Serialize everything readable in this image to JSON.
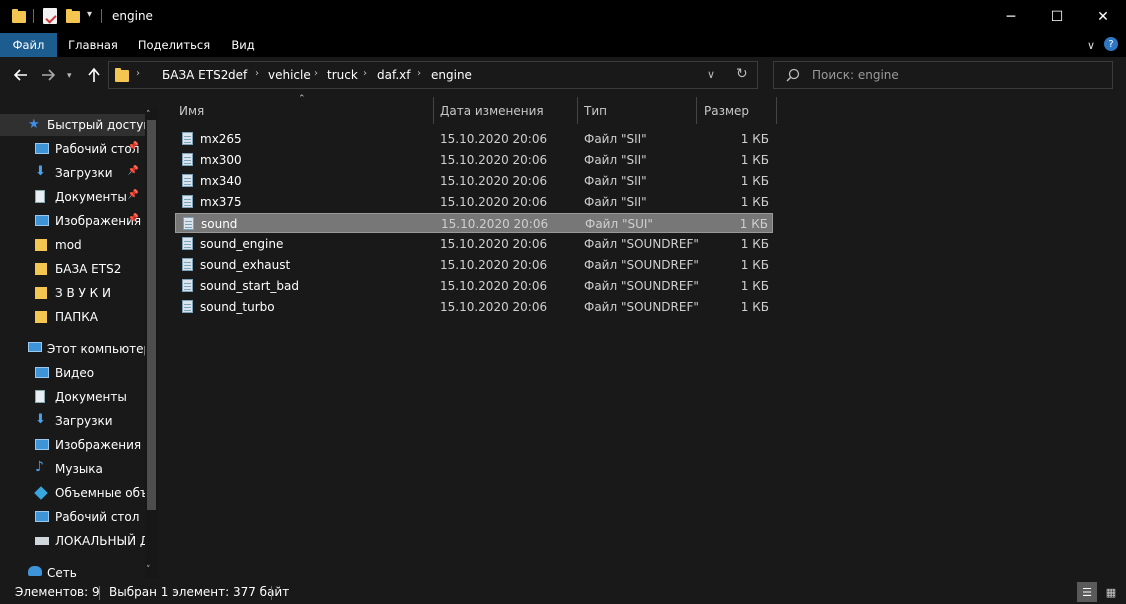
{
  "window": {
    "title": "engine",
    "minimize_glyph": "─",
    "maximize_glyph": "☐",
    "close_glyph": "✕"
  },
  "ribbon": {
    "tabs": [
      "Файл",
      "Главная",
      "Поделиться",
      "Вид"
    ],
    "expand_glyph": "∨",
    "help_glyph": "?"
  },
  "address": {
    "breadcrumbs": [
      "БАЗА ETS2",
      "def",
      "vehicle",
      "truck",
      "daf.xf",
      "engine"
    ],
    "search_placeholder": "Поиск: engine"
  },
  "sidebar": {
    "quick_access": {
      "label": "Быстрый доступ",
      "items": [
        {
          "label": "Рабочий стол",
          "pinned": true,
          "icon": "desktop-icon"
        },
        {
          "label": "Загрузки",
          "pinned": true,
          "icon": "download-icon"
        },
        {
          "label": "Документы",
          "pinned": true,
          "icon": "documents-icon"
        },
        {
          "label": "Изображения",
          "pinned": true,
          "icon": "pictures-icon"
        },
        {
          "label": "mod",
          "pinned": false,
          "icon": "folder-icon"
        },
        {
          "label": "БАЗА ETS2",
          "pinned": false,
          "icon": "folder-icon"
        },
        {
          "label": "З В У К И",
          "pinned": false,
          "icon": "folder-icon"
        },
        {
          "label": "ПАПКА",
          "pinned": false,
          "icon": "folder-icon"
        }
      ]
    },
    "this_pc": {
      "label": "Этот компьютер",
      "items": [
        {
          "label": "Видео",
          "icon": "video-icon"
        },
        {
          "label": "Документы",
          "icon": "documents-icon"
        },
        {
          "label": "Загрузки",
          "icon": "download-icon"
        },
        {
          "label": "Изображения",
          "icon": "pictures-icon"
        },
        {
          "label": "Музыка",
          "icon": "music-icon"
        },
        {
          "label": "Объемные объекты",
          "icon": "3d-objects-icon"
        },
        {
          "label": "Рабочий стол",
          "icon": "desktop-icon"
        },
        {
          "label": "ЛОКАЛЬНЫЙ ДИСК",
          "icon": "drive-icon"
        }
      ]
    },
    "network": {
      "label": "Сеть"
    }
  },
  "columns": {
    "name": "Имя",
    "date": "Дата изменения",
    "type": "Тип",
    "size": "Размер"
  },
  "files": [
    {
      "name": "mx265",
      "date": "15.10.2020 20:06",
      "type": "Файл \"SII\"",
      "size": "1 КБ",
      "selected": false
    },
    {
      "name": "mx300",
      "date": "15.10.2020 20:06",
      "type": "Файл \"SII\"",
      "size": "1 КБ",
      "selected": false
    },
    {
      "name": "mx340",
      "date": "15.10.2020 20:06",
      "type": "Файл \"SII\"",
      "size": "1 КБ",
      "selected": false
    },
    {
      "name": "mx375",
      "date": "15.10.2020 20:06",
      "type": "Файл \"SII\"",
      "size": "1 КБ",
      "selected": false
    },
    {
      "name": "sound",
      "date": "15.10.2020 20:06",
      "type": "Файл \"SUI\"",
      "size": "1 КБ",
      "selected": true
    },
    {
      "name": "sound_engine",
      "date": "15.10.2020 20:06",
      "type": "Файл \"SOUNDREF\"",
      "size": "1 КБ",
      "selected": false
    },
    {
      "name": "sound_exhaust",
      "date": "15.10.2020 20:06",
      "type": "Файл \"SOUNDREF\"",
      "size": "1 КБ",
      "selected": false
    },
    {
      "name": "sound_start_bad",
      "date": "15.10.2020 20:06",
      "type": "Файл \"SOUNDREF\"",
      "size": "1 КБ",
      "selected": false
    },
    {
      "name": "sound_turbo",
      "date": "15.10.2020 20:06",
      "type": "Файл \"SOUNDREF\"",
      "size": "1 КБ",
      "selected": false
    }
  ],
  "status": {
    "count": "Элементов: 9",
    "selection": "Выбран 1 элемент: 377 байт"
  },
  "colors": {
    "background": "#191919",
    "titlebar": "#000000",
    "file_tab": "#1d5c8e",
    "selection": "#777777",
    "folder": "#f4c550"
  }
}
